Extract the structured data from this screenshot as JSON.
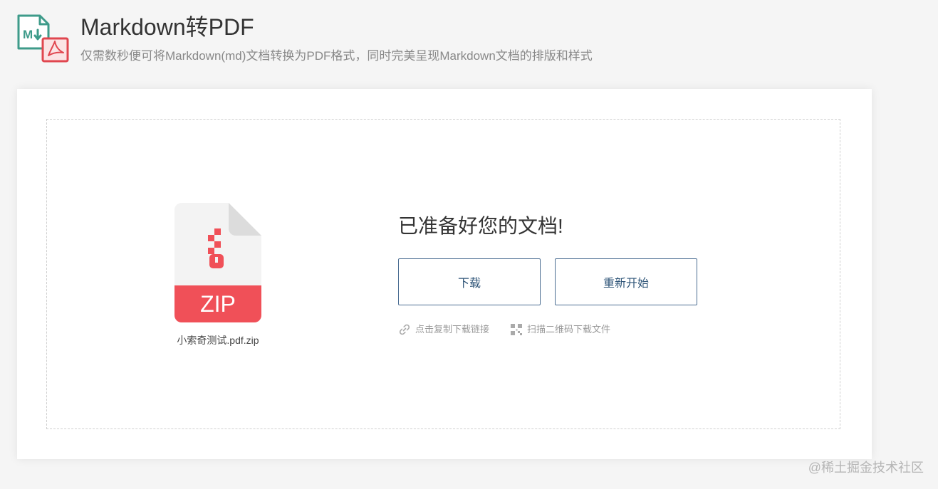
{
  "header": {
    "logo_icon": "markdown-to-pdf-logo-icon",
    "title": "Markdown转PDF",
    "subtitle": "仅需数秒便可将Markdown(md)文档转换为PDF格式，同时完美呈现Markdown文档的排版和样式"
  },
  "file": {
    "icon": "zip-file-icon",
    "type_label": "ZIP",
    "name": "小索奇测试.pdf.zip"
  },
  "result": {
    "title": "已准备好您的文档!",
    "download_label": "下载",
    "restart_label": "重新开始",
    "copy_link_label": "点击复制下载链接",
    "qr_label": "扫描二维码下载文件"
  },
  "watermark": "@稀土掘金技术社区",
  "colors": {
    "background": "#f5f5f5",
    "card": "#ffffff",
    "button_border": "#4a6d92",
    "button_text": "#2f5578",
    "zip_red": "#f05058",
    "logo_green": "#3e9b8a",
    "logo_red": "#e0464f"
  }
}
